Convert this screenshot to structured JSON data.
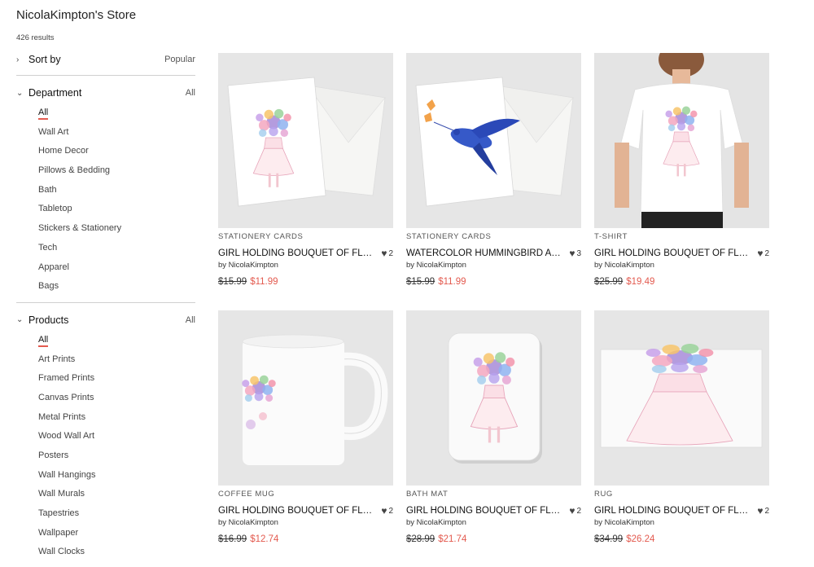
{
  "store": {
    "title": "NicolaKimpton's Store",
    "results": "426 results"
  },
  "sort": {
    "label": "Sort by",
    "value": "Popular"
  },
  "department": {
    "label": "Department",
    "value": "All",
    "items": [
      "All",
      "Wall Art",
      "Home Decor",
      "Pillows & Bedding",
      "Bath",
      "Tabletop",
      "Stickers & Stationery",
      "Tech",
      "Apparel",
      "Bags"
    ]
  },
  "products": {
    "label": "Products",
    "value": "All",
    "items": [
      "All",
      "Art Prints",
      "Framed Prints",
      "Canvas Prints",
      "Metal Prints",
      "Wood Wall Art",
      "Posters",
      "Wall Hangings",
      "Wall Murals",
      "Tapestries",
      "Wallpaper",
      "Wall Clocks"
    ]
  },
  "cards": [
    {
      "category": "STATIONERY CARDS",
      "title": "GIRL HOLDING BOUQUET OF FLOWERS",
      "likes": "2",
      "by": "by NicolaKimpton",
      "old_price": "$15.99",
      "new_price": "$11.99"
    },
    {
      "category": "STATIONERY CARDS",
      "title": "WATERCOLOR HUMMINGBIRD AND FLOWERS",
      "likes": "3",
      "by": "by NicolaKimpton",
      "old_price": "$15.99",
      "new_price": "$11.99"
    },
    {
      "category": "T-SHIRT",
      "title": "GIRL HOLDING BOUQUET OF FLOWERS",
      "likes": "2",
      "by": "by NicolaKimpton",
      "old_price": "$25.99",
      "new_price": "$19.49"
    },
    {
      "category": "COFFEE MUG",
      "title": "GIRL HOLDING BOUQUET OF FLOWERS",
      "likes": "2",
      "by": "by NicolaKimpton",
      "old_price": "$16.99",
      "new_price": "$12.74"
    },
    {
      "category": "BATH MAT",
      "title": "GIRL HOLDING BOUQUET OF FLOWERS",
      "likes": "2",
      "by": "by NicolaKimpton",
      "old_price": "$28.99",
      "new_price": "$21.74"
    },
    {
      "category": "RUG",
      "title": "GIRL HOLDING BOUQUET OF FLOWERS",
      "likes": "2",
      "by": "by NicolaKimpton",
      "old_price": "$34.99",
      "new_price": "$26.24"
    }
  ],
  "colors": {
    "accent": "#e35a4f",
    "thumb_bg": "#e5e5e5"
  }
}
